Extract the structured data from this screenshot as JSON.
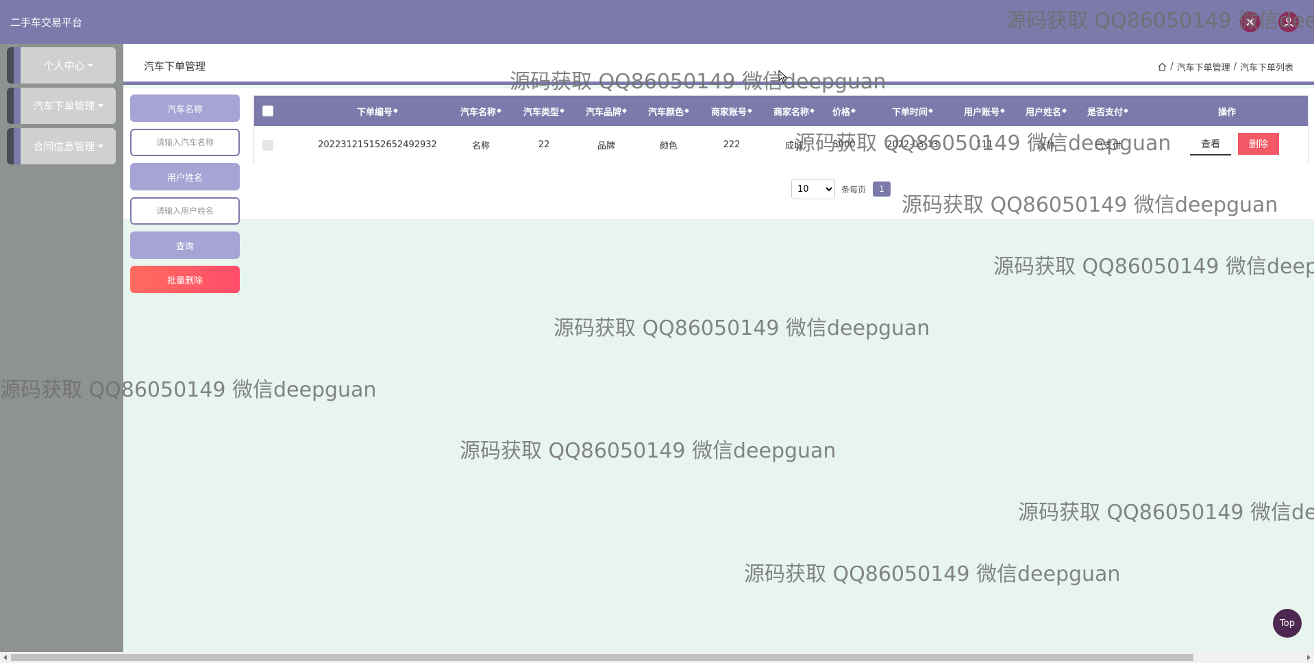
{
  "header": {
    "brand": "二手车交易平台",
    "colors": {
      "primary": "#7b7aaa",
      "icon_bg": "#8a2d5a"
    },
    "icons": [
      "fullscreen-exit-icon",
      "user-icon"
    ]
  },
  "sidebar": {
    "items": [
      {
        "label": "个人中心"
      },
      {
        "label": "汽车下单管理"
      },
      {
        "label": "合同信息管理"
      }
    ]
  },
  "page": {
    "title": "汽车下单管理",
    "breadcrumb": [
      "汽车下单管理",
      "汽车下单列表"
    ],
    "breadcrumb_sep": "/"
  },
  "search": {
    "car_name_label": "汽车名称",
    "car_name_placeholder": "请输入汽车名称",
    "user_name_label": "用户姓名",
    "user_name_placeholder": "请输入用户姓名",
    "query_button": "查询",
    "batch_delete_button": "批量删除"
  },
  "table": {
    "columns": [
      "下单编号",
      "汽车名称",
      "汽车类型",
      "汽车品牌",
      "汽车颜色",
      "商家账号",
      "商家名称",
      "价格",
      "下单时间",
      "用户账号",
      "用户姓名",
      "是否支付",
      "操作"
    ],
    "sort_glyph": "◆",
    "rows": [
      {
        "order_no": "20223121515265249293​2",
        "car_name": "名称",
        "car_type": "22",
        "brand": "品牌",
        "color": "颜色",
        "merchant_account": "222",
        "merchant_name": "成城",
        "price": "5000",
        "order_time": "2022-03-13",
        "user_account": "111",
        "user_name": "张静",
        "paid": "已支付",
        "actions": {
          "view": "查看",
          "delete": "删除"
        }
      }
    ]
  },
  "pager": {
    "page_size": "10",
    "page_size_options": [
      "10"
    ],
    "per_page_label": "条每页",
    "current_page": "1"
  },
  "watermark": "源码获取 QQ86050149 微信deepguan",
  "top_button": "Top"
}
